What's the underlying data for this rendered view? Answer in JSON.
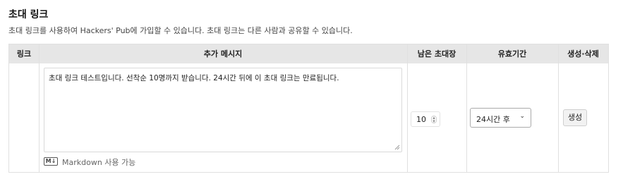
{
  "section": {
    "title": "초대 링크",
    "description": "초대 링크를 사용하여 Hackers' Pub에 가입할 수 있습니다. 초대 링크는 다른 사람과 공유할 수 있습니다."
  },
  "table": {
    "headers": [
      "링크",
      "추가 메시지",
      "남은 초대장",
      "유효기간",
      "생성·삭제"
    ]
  },
  "form": {
    "message_value": "초대 링크 테스트입니다. 선착순 10명까지 받습니다. 24시간 뒤에 이 초대 링크는 만료됩니다.",
    "markdown_badge": "M↓",
    "markdown_hint": "Markdown 사용 가능",
    "remaining_invites": "10",
    "expiry_selected": "24시간 후",
    "create_label": "생성"
  },
  "icons": {
    "markdown": "markdown-icon",
    "spinner": "number-spinner-icon",
    "dropdown": "chevron-down-icon",
    "resize": "resize-handle-icon"
  }
}
